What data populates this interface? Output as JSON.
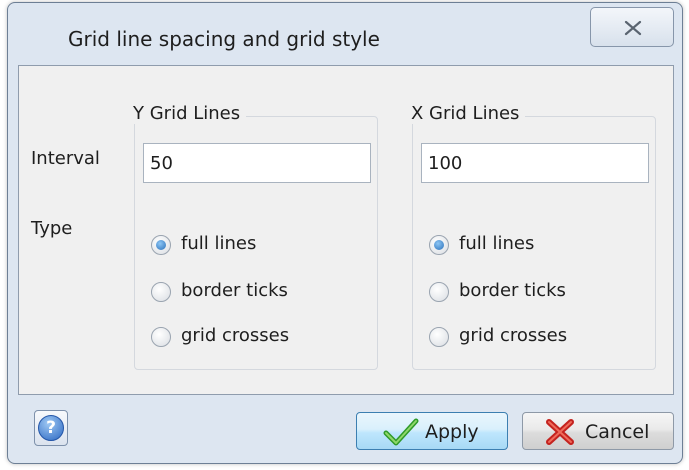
{
  "window": {
    "title": "Grid line spacing and grid style",
    "close_icon": "close-icon"
  },
  "labels": {
    "interval": "Interval",
    "type": "Type"
  },
  "y_group": {
    "title": "Y Grid Lines",
    "interval_value": "50",
    "options": [
      {
        "label": "full lines",
        "checked": true
      },
      {
        "label": "border ticks",
        "checked": false
      },
      {
        "label": "grid crosses",
        "checked": false
      }
    ]
  },
  "x_group": {
    "title": "X Grid Lines",
    "interval_value": "100",
    "options": [
      {
        "label": "full lines",
        "checked": true
      },
      {
        "label": "border ticks",
        "checked": false
      },
      {
        "label": "grid crosses",
        "checked": false
      }
    ]
  },
  "buttons": {
    "help_icon": "help-icon",
    "apply_label": "Apply",
    "apply_icon": "checkmark-icon",
    "cancel_label": "Cancel",
    "cancel_icon": "x-mark-icon"
  },
  "colors": {
    "window_frame": "#dde6f1",
    "client_bg": "#f0f0f0",
    "radio_checked": "#2a6fb9",
    "apply_border": "#3c7fb1"
  }
}
